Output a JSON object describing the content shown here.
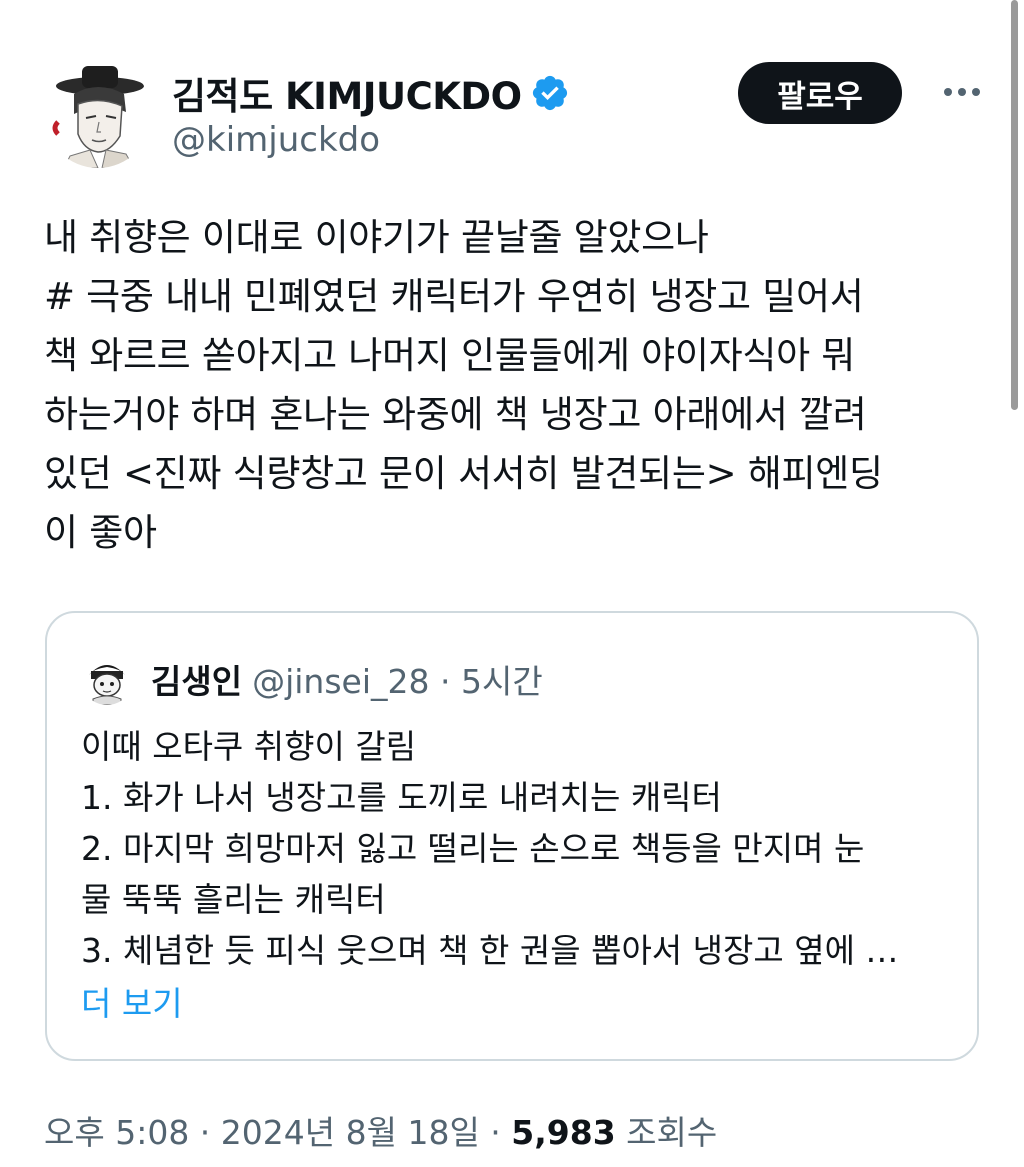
{
  "author": {
    "display_name": "김적도 KIMJUCKDO",
    "handle": "@kimjuckdo",
    "verified": true,
    "badge_color": "#1d9bf0"
  },
  "actions": {
    "follow_label": "팔로우",
    "more_icon": "more-horizontal-icon"
  },
  "tweet": {
    "lines": [
      "내 취향은 이대로 이야기가 끝날줄 알았으나",
      "# 극중 내내 민폐였던 캐릭터가 우연히 냉장고 밀어서",
      "책 와르르 쏟아지고 나머지 인물들에게 야이자식아 뭐",
      "하는거야 하며 혼나는 와중에 책 냉장고 아래에서 깔려",
      "있던 <진짜 식량창고 문이 서서히 발견되는> 해피엔딩",
      "이 좋아"
    ]
  },
  "quote": {
    "display_name": "김생인",
    "handle_time": "@jinsei_28 · 5시간",
    "lines": [
      "이때 오타쿠 취향이 갈림",
      "1. 화가 나서 냉장고를 도끼로 내려치는 캐릭터",
      "2. 마지막 희망마저 잃고 떨리는 손으로 책등을 만지며 눈",
      "물 뚝뚝 흘리는 캐릭터",
      "3. 체념한 듯 피식 웃으며 책 한 권을 뽑아서 냉장고 옆에 …"
    ],
    "show_more": "더 보기",
    "link_color": "#1d9bf0"
  },
  "meta": {
    "timestamp": "오후 5:08 · 2024년 8월 18일 · ",
    "views_count": "5,983",
    "views_label": " 조회수"
  }
}
